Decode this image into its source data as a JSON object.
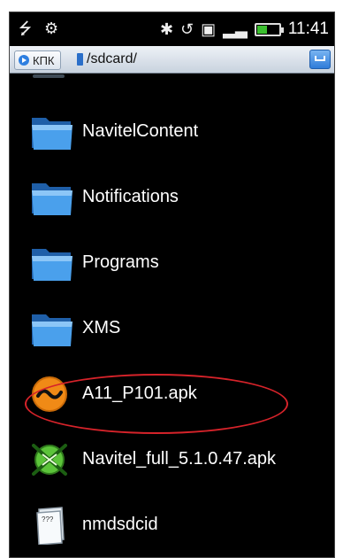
{
  "status_bar": {
    "time": "11:41",
    "battery_level_fraction": 0.45,
    "left_icons": [
      "usb-icon",
      "debug-icon"
    ],
    "right_icons": [
      "bluetooth-icon",
      "sync-icon",
      "sd-card-icon",
      "signal-icon",
      "battery-icon"
    ]
  },
  "path_bar": {
    "button_label": "КПК",
    "path": "/sdcard/"
  },
  "files": [
    {
      "name": "NavitelContent",
      "type": "folder",
      "icon": "folder-icon"
    },
    {
      "name": "Notifications",
      "type": "folder",
      "icon": "folder-icon"
    },
    {
      "name": "Programs",
      "type": "folder",
      "icon": "folder-icon"
    },
    {
      "name": "XMS",
      "type": "folder",
      "icon": "folder-icon"
    },
    {
      "name": "A11_P101.apk",
      "type": "apk",
      "icon": "apk-orange-icon",
      "highlighted": true
    },
    {
      "name": "Navitel_full_5.1.0.47.apk",
      "type": "apk",
      "icon": "navitel-app-icon"
    },
    {
      "name": "nmdsdcid",
      "type": "file",
      "icon": "unknown-file-icon"
    }
  ],
  "colors": {
    "background": "#000000",
    "highlight_oval": "#d6232a",
    "folder_blue": "#3c8fe0"
  }
}
